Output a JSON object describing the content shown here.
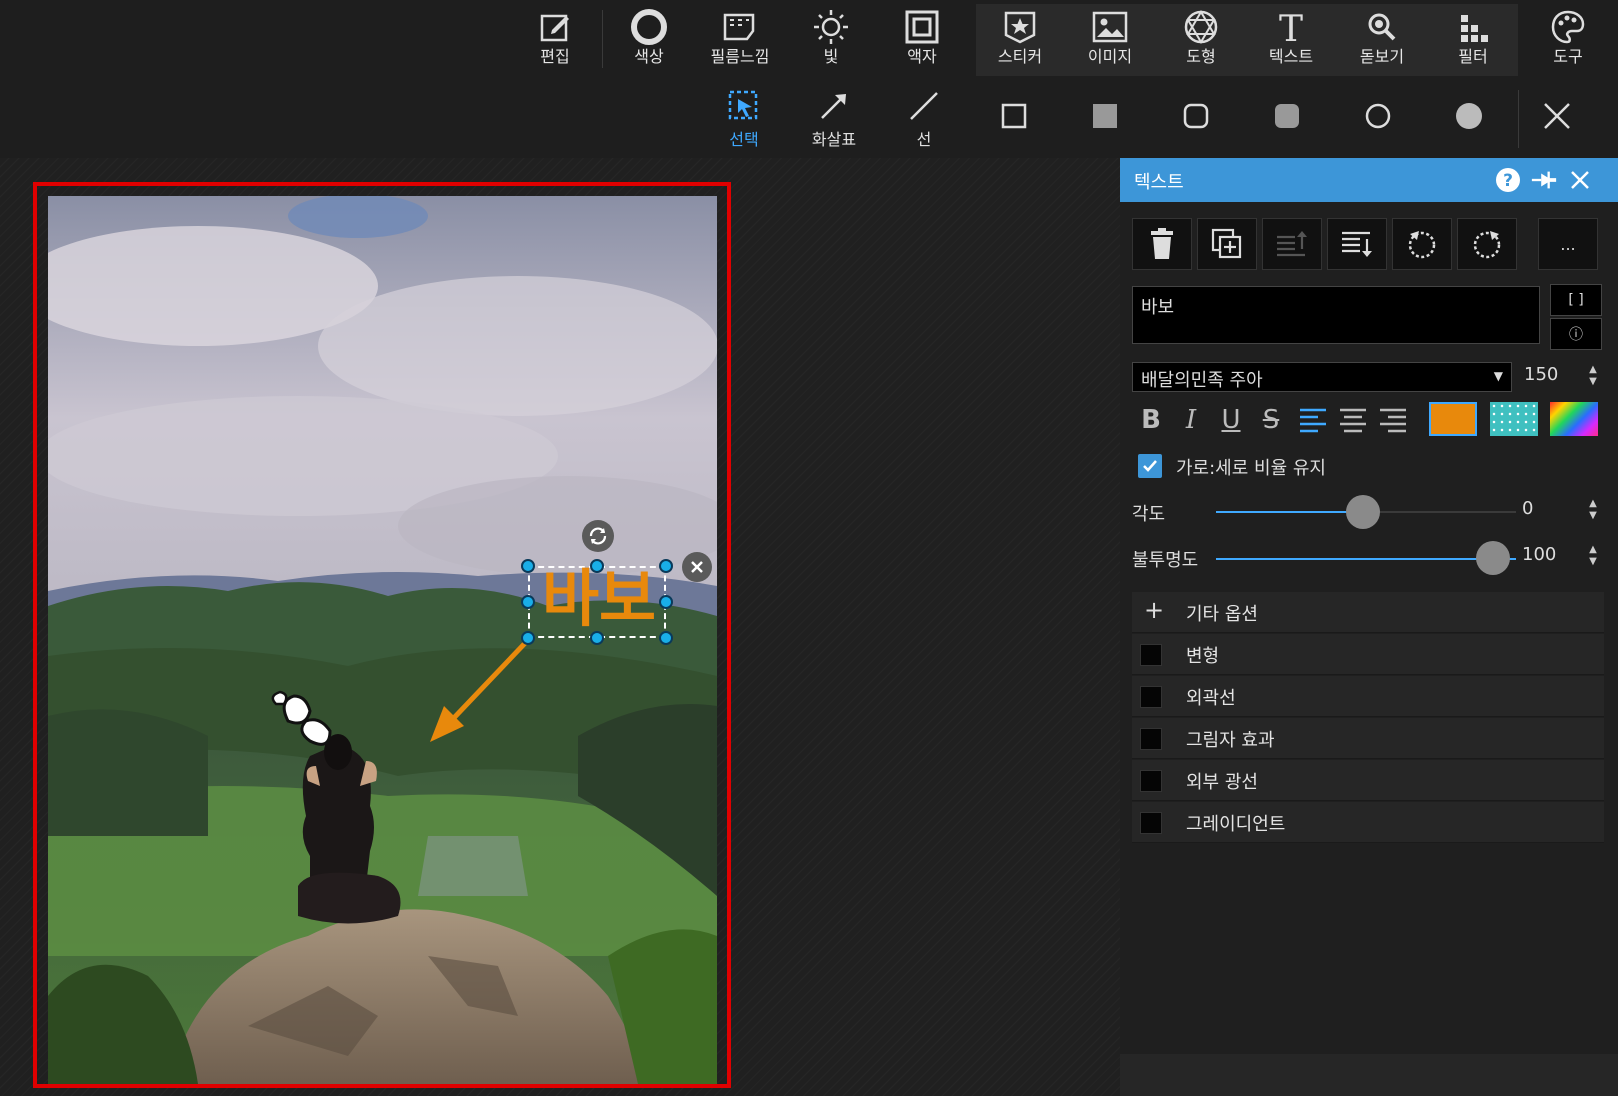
{
  "toolbar": {
    "items": [
      {
        "label": "편집",
        "icon": "edit-icon"
      },
      {
        "label": "색상",
        "icon": "circle-icon"
      },
      {
        "label": "필름느낌",
        "icon": "film-icon"
      },
      {
        "label": "빛",
        "icon": "sun-icon"
      },
      {
        "label": "액자",
        "icon": "frame-icon"
      },
      {
        "label": "스티커",
        "icon": "sticker-icon"
      },
      {
        "label": "이미지",
        "icon": "image-icon"
      },
      {
        "label": "도형",
        "icon": "shape-icon"
      },
      {
        "label": "텍스트",
        "icon": "text-icon"
      },
      {
        "label": "돋보기",
        "icon": "magnifier-icon"
      },
      {
        "label": "필터",
        "icon": "filter-icon"
      },
      {
        "label": "도구",
        "icon": "palette-icon"
      }
    ]
  },
  "subtoolbar": {
    "items": [
      {
        "label": "선택",
        "icon": "select-icon",
        "active": true
      },
      {
        "label": "화살표",
        "icon": "arrow-icon"
      },
      {
        "label": "선",
        "icon": "line-icon"
      }
    ],
    "shapes": [
      "square-outline-icon",
      "square-filled-icon",
      "rounded-square-outline-icon",
      "rounded-square-filled-icon",
      "circle-outline-icon",
      "circle-filled-icon"
    ],
    "close_icon": "close-icon"
  },
  "canvas": {
    "text_object": "바보",
    "text_color": "#e8890c"
  },
  "panel": {
    "title": "텍스트",
    "text_value": "바보",
    "bracket_button": "[ ]",
    "info_button": "ⓘ",
    "font": "배달의민족 주아",
    "font_size": "150",
    "more_button": "...",
    "fill_color": "#e8890c",
    "keep_ratio_label": "가로:세로 비율 유지",
    "keep_ratio_checked": true,
    "angle_label": "각도",
    "angle_value": "0",
    "opacity_label": "불투명도",
    "opacity_value": "100",
    "more_options_label": "기타 옵션",
    "options": [
      "변형",
      "외곽선",
      "그림자 효과",
      "외부 광선",
      "그레이디언트"
    ]
  }
}
